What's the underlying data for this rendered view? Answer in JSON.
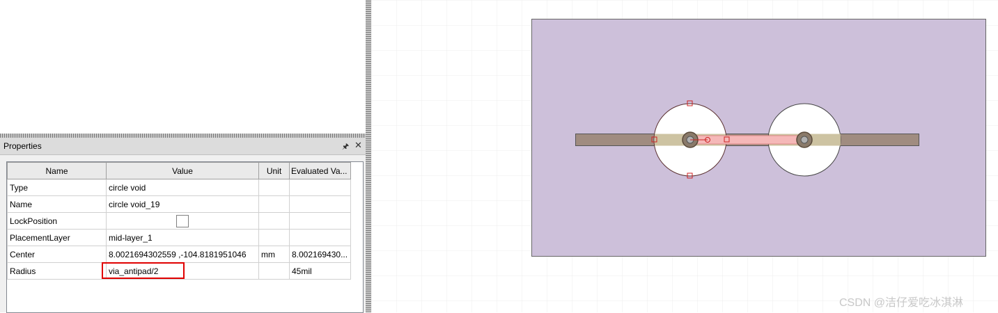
{
  "properties_panel": {
    "title": "Properties",
    "pin_icon": "pin-icon",
    "close_icon": "close-icon",
    "columns": [
      "Name",
      "Value",
      "Unit",
      "Evaluated Va..."
    ],
    "rows": [
      {
        "name": "Type",
        "value": "circle void",
        "unit": "",
        "evaluated": ""
      },
      {
        "name": "Name",
        "value": "circle void_19",
        "unit": "",
        "evaluated": ""
      },
      {
        "name": "LockPosition",
        "value": "",
        "unit": "",
        "evaluated": "",
        "checkbox": false
      },
      {
        "name": "PlacementLayer",
        "value": "mid-layer_1",
        "unit": "",
        "evaluated": ""
      },
      {
        "name": "Center",
        "value": "8.0021694302559 ,-104.8181951046",
        "unit": "mm",
        "evaluated": "8.002169430..."
      },
      {
        "name": "Radius",
        "value": "via_antipad/2",
        "unit": "",
        "evaluated": "45mil"
      }
    ],
    "highlighted_row": "Radius"
  },
  "canvas": {
    "board_color": "#cdc0da",
    "trace_color": "#a08c80",
    "highlight_color": "#f5b8b8",
    "selection_color": "#cc2222"
  },
  "watermark": "CSDN @洁仔爱吃冰淇淋"
}
